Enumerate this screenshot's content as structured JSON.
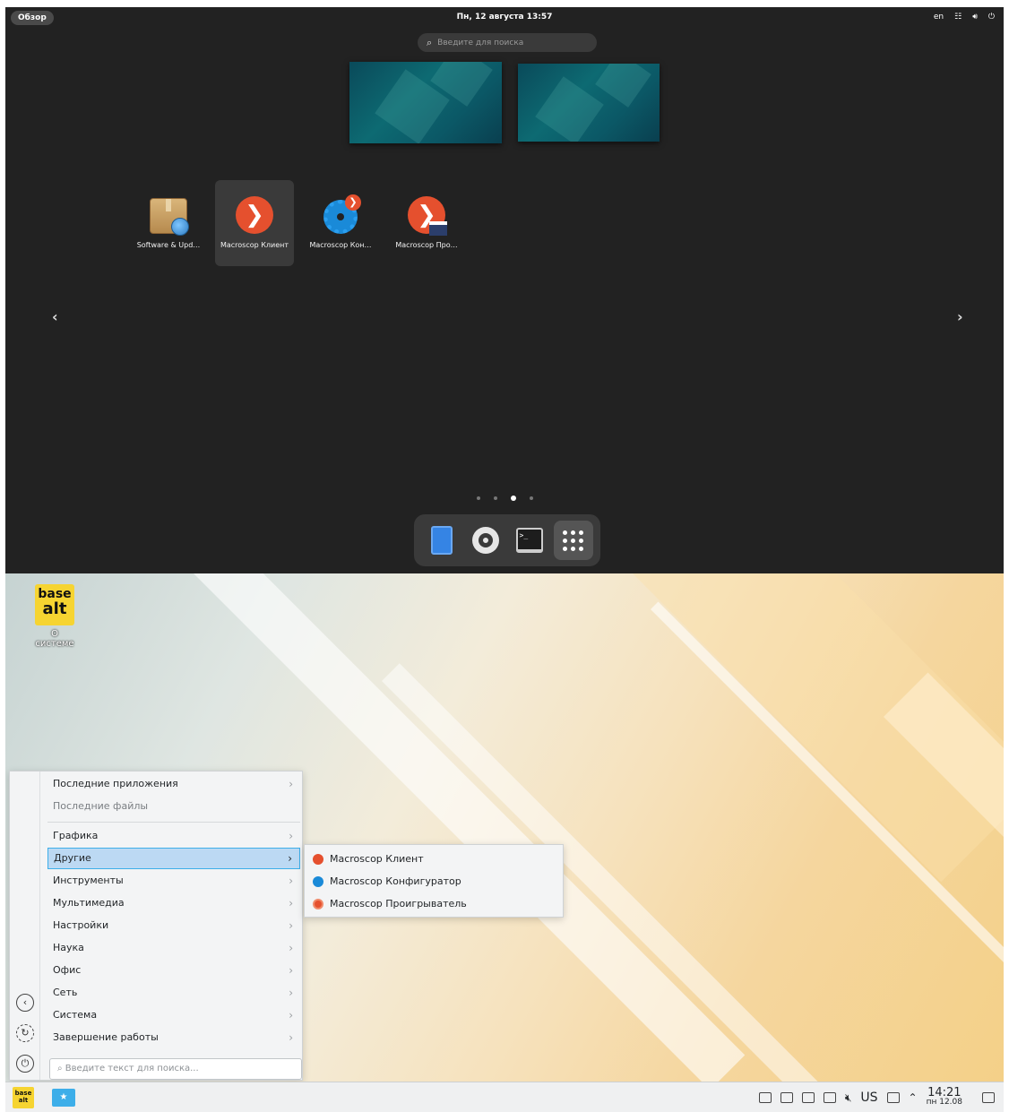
{
  "gnome": {
    "overview_label": "Обзор",
    "clock": "Пн, 12 августа  13:57",
    "lang": "en",
    "tray_icons": [
      "network-icon",
      "volume-icon",
      "power-icon"
    ],
    "search_placeholder": "Введите для поиска",
    "apps": [
      {
        "label": "Software & Upd…",
        "icon": "package-icon",
        "selected": false
      },
      {
        "label": "Macroscop Клиент",
        "icon": "macroscop-client-icon",
        "selected": true
      },
      {
        "label": "Macroscop Кон…",
        "icon": "macroscop-config-icon",
        "selected": false
      },
      {
        "label": "Macroscop Про…",
        "icon": "macroscop-player-icon",
        "selected": false
      }
    ],
    "nav_prev": "‹",
    "nav_next": "›",
    "pages": 4,
    "current_page": 3,
    "dash": [
      "files-icon",
      "settings-icon",
      "terminal-icon",
      "show-apps-icon"
    ],
    "terminal_glyph": ">_"
  },
  "kde": {
    "desktop_icon": {
      "logo_line1": "base",
      "logo_line2": "alt",
      "label": "О системе"
    },
    "menu": {
      "recent_apps": "Последние приложения",
      "recent_files": "Последние файлы",
      "categories": [
        "Графика",
        "Другие",
        "Инструменты",
        "Мультимедиа",
        "Настройки",
        "Наука",
        "Офис",
        "Сеть",
        "Система",
        "Завершение работы"
      ],
      "selected_category": "Другие",
      "search_placeholder": "Введите текст для поиска...",
      "chevron": "›"
    },
    "submenu": [
      {
        "label": "Macroscop Клиент",
        "icon": "macroscop-client-icon"
      },
      {
        "label": "Macroscop Конфигуратор",
        "icon": "macroscop-config-icon"
      },
      {
        "label": "Macroscop Проигрыватель",
        "icon": "macroscop-player-icon"
      }
    ],
    "panel": {
      "launcher_line1": "base",
      "launcher_line2": "alt",
      "layout": "US",
      "time": "14:21",
      "date": "пн 12.08"
    }
  }
}
